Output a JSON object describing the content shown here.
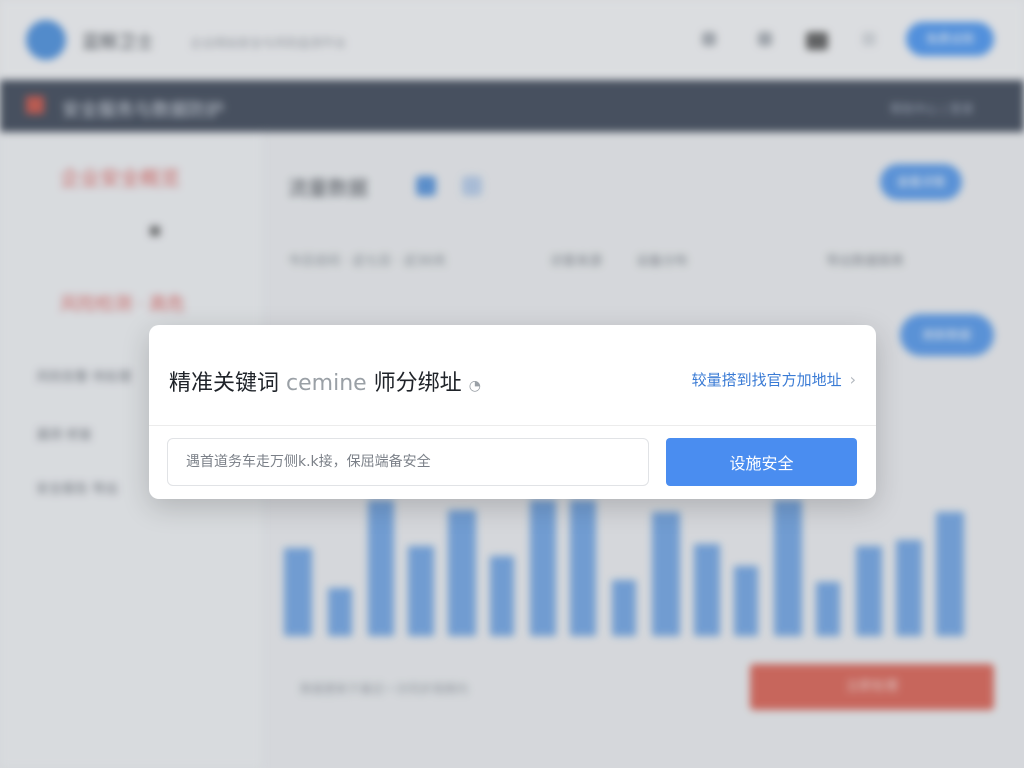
{
  "background": {
    "brand": "蓝鲸卫士",
    "brand_sub": "企业网站安全与风险监测平台",
    "topbar_button": "免费试用",
    "nav_title": "安全服务与数据防护",
    "nav_right": "帮助中心 | 登录",
    "sidebar": {
      "red_heading_1": "企业安全概览",
      "red_heading_2": "风险检测 · 高危",
      "items": [
        "风险告警  待处理",
        "漏洞    修复",
        "安全报告  导出"
      ]
    },
    "main_title": "流量数据",
    "main_button": "查看详情",
    "filters": [
      "今日访问 · 近七日 · 近30天",
      "访客来源",
      "设备分布",
      "导出数据报表"
    ],
    "chart_button": "刷新数据",
    "footer_text": "数据更新于最近一次同步周期内",
    "danger_button": "立即处理"
  },
  "modal": {
    "title": "精准关键词",
    "title_mid": "cemine",
    "title_tail": "师分绑址",
    "link": "较量搭到找官方加地址",
    "input_placeholder": "遇首道务车走万侧k.k接，保屈端备安全",
    "button": "设施安全"
  },
  "colors": {
    "accent": "#4a8df0",
    "link": "#3a7bd5",
    "danger": "#d64a3a",
    "nav": "#1f2a3d"
  },
  "icons": {
    "link_chevron": "chevron-right-icon",
    "title_cursor": "cursor-icon"
  }
}
